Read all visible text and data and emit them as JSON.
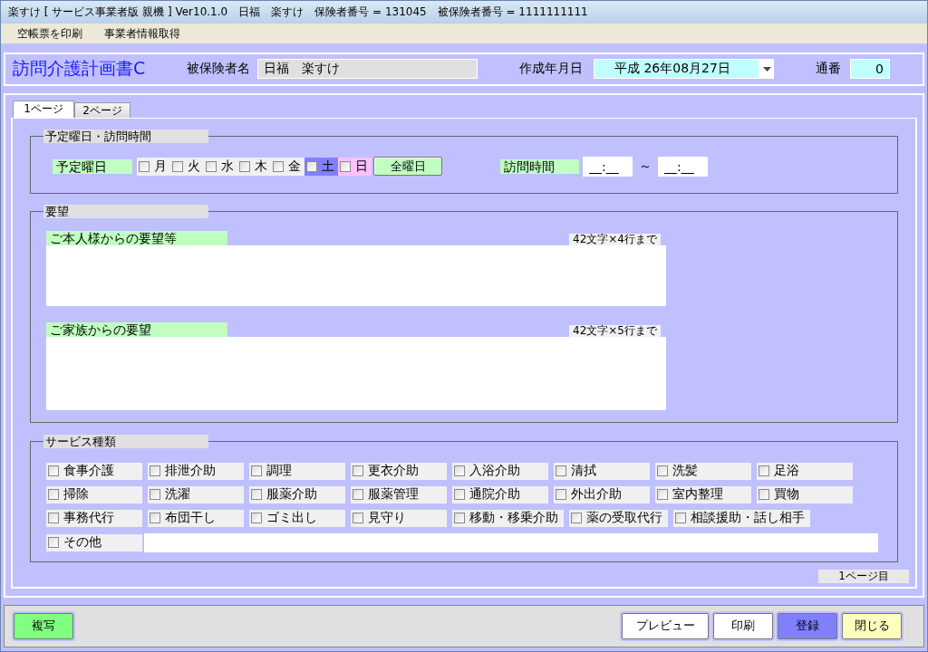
{
  "window": {
    "title": "楽すけ [ サービス事業者版 親機 ] Ver10.1.0　日福　楽すけ　保険者番号 = 131045　被保険者番号 = 1111111111"
  },
  "menu": [
    "空帳票を印刷",
    "事業者情報取得"
  ],
  "header": {
    "title": "訪問介護計画書C",
    "insured_label": "被保険者名",
    "insured_value": "日福　楽すけ",
    "date_label": "作成年月日",
    "date_value": "平成 26年08月27日",
    "serial_label": "通番",
    "serial_value": "0"
  },
  "tabs": [
    {
      "label": "1ページ",
      "selected": true
    },
    {
      "label": "2ページ",
      "selected": false
    }
  ],
  "schedule": {
    "legend": "予定曜日・訪問時間",
    "days_label": "予定曜日",
    "days": [
      {
        "label": "月",
        "checked": false,
        "color": "#f0f0f0"
      },
      {
        "label": "火",
        "checked": false,
        "color": "#f0f0f0"
      },
      {
        "label": "水",
        "checked": false,
        "color": "#f0f0f0"
      },
      {
        "label": "木",
        "checked": false,
        "color": "#f0f0f0"
      },
      {
        "label": "金",
        "checked": false,
        "color": "#f0f0f0"
      },
      {
        "label": "土",
        "checked": false,
        "color": "#8080ff"
      },
      {
        "label": "日",
        "checked": false,
        "color": "#ffc0ff"
      }
    ],
    "all_days_button": "全曜日",
    "time_label": "訪問時間",
    "time_from": "__:__",
    "time_separator": "～",
    "time_to": "__:__"
  },
  "requests": {
    "legend": "要望",
    "items": [
      {
        "label": "ご本人様からの要望等",
        "limit": "42文字×4行まで"
      },
      {
        "label": "ご家族からの要望",
        "limit": "42文字×5行まで"
      }
    ]
  },
  "services": {
    "legend": "サービス種類",
    "rows": [
      [
        {
          "label": "食事介護",
          "checked": false
        },
        {
          "label": "排泄介助",
          "checked": false
        },
        {
          "label": "調理",
          "checked": false
        },
        {
          "label": "更衣介助",
          "checked": false
        },
        {
          "label": "入浴介助",
          "checked": false
        },
        {
          "label": "清拭",
          "checked": false
        },
        {
          "label": "洗髪",
          "checked": false
        },
        {
          "label": "足浴",
          "checked": false
        }
      ],
      [
        {
          "label": "掃除",
          "checked": false
        },
        {
          "label": "洗濯",
          "checked": false
        },
        {
          "label": "服薬介助",
          "checked": false
        },
        {
          "label": "服薬管理",
          "checked": false
        },
        {
          "label": "通院介助",
          "checked": false
        },
        {
          "label": "外出介助",
          "checked": false
        },
        {
          "label": "室内整理",
          "checked": false
        },
        {
          "label": "買物",
          "checked": false
        }
      ],
      [
        {
          "label": "事務代行",
          "checked": false
        },
        {
          "label": "布団干し",
          "checked": false
        },
        {
          "label": "ゴミ出し",
          "checked": false
        },
        {
          "label": "見守り",
          "checked": false
        },
        {
          "label": "移動・移乗介助",
          "checked": false
        },
        {
          "label": "薬の受取代行",
          "checked": false
        },
        {
          "label": "相談援助・話し相手",
          "checked": false
        }
      ]
    ],
    "other": {
      "label": "その他",
      "checked": false
    }
  },
  "page_indicator": "1ページ目",
  "buttons_left": [
    {
      "label": "複写",
      "color": "#80ff80"
    }
  ],
  "buttons_right": [
    {
      "label": "プレビュー",
      "color": "#ffffff"
    },
    {
      "label": "印刷",
      "color": "#ffffff"
    },
    {
      "label": "登録",
      "color": "#8080ff"
    },
    {
      "label": "閉じる",
      "color": "#ffffc0"
    }
  ]
}
